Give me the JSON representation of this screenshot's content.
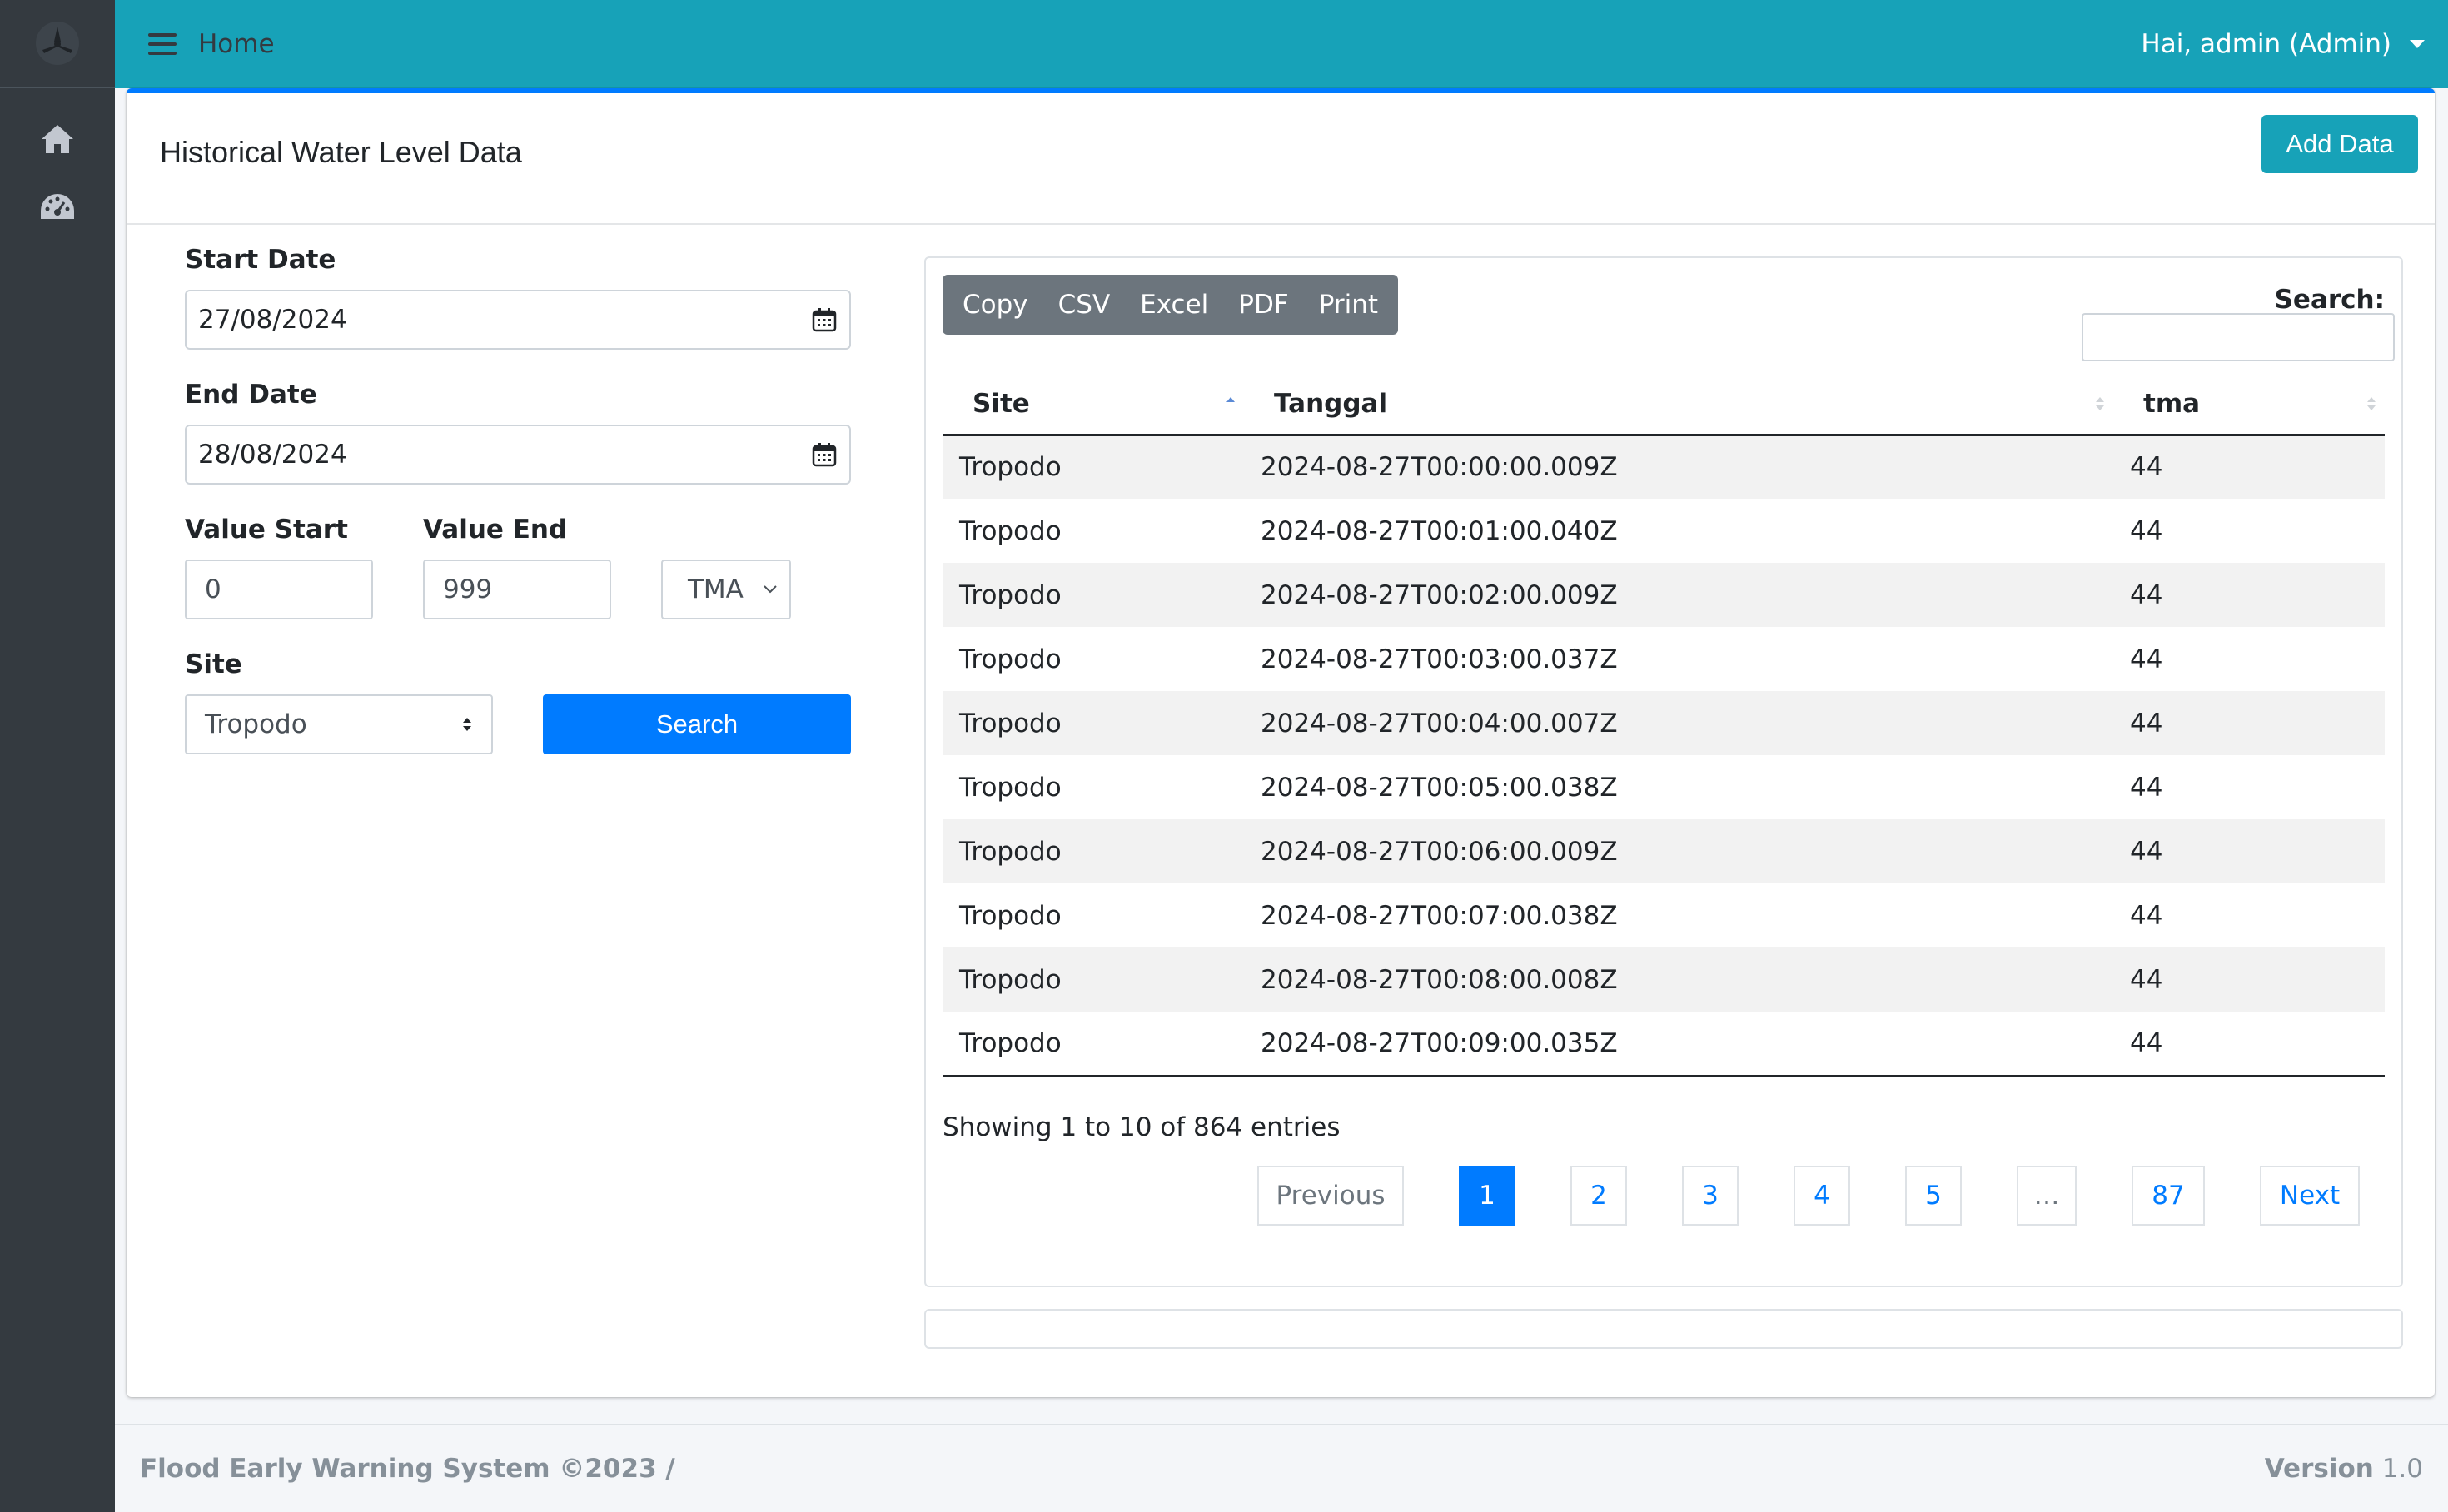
{
  "topbar": {
    "home_label": "Home",
    "user_label": "Hai, admin (Admin)"
  },
  "card": {
    "title": "Historical Water Level Data",
    "add_button": "Add Data"
  },
  "form": {
    "start_date_label": "Start Date",
    "start_date_value": "27/08/2024",
    "end_date_label": "End Date",
    "end_date_value": "28/08/2024",
    "value_start_label": "Value Start",
    "value_start_value": "0",
    "value_end_label": "Value End",
    "value_end_value": "999",
    "type_select_value": "TMA",
    "site_label": "Site",
    "site_select_value": "Tropodo",
    "search_button": "Search"
  },
  "table_panel": {
    "export_buttons": [
      "Copy",
      "CSV",
      "Excel",
      "PDF",
      "Print"
    ],
    "search_label": "Search:",
    "columns": [
      "Site",
      "Tanggal",
      "tma"
    ],
    "rows": [
      [
        "Tropodo",
        "2024-08-27T00:00:00.009Z",
        "44"
      ],
      [
        "Tropodo",
        "2024-08-27T00:01:00.040Z",
        "44"
      ],
      [
        "Tropodo",
        "2024-08-27T00:02:00.009Z",
        "44"
      ],
      [
        "Tropodo",
        "2024-08-27T00:03:00.037Z",
        "44"
      ],
      [
        "Tropodo",
        "2024-08-27T00:04:00.007Z",
        "44"
      ],
      [
        "Tropodo",
        "2024-08-27T00:05:00.038Z",
        "44"
      ],
      [
        "Tropodo",
        "2024-08-27T00:06:00.009Z",
        "44"
      ],
      [
        "Tropodo",
        "2024-08-27T00:07:00.038Z",
        "44"
      ],
      [
        "Tropodo",
        "2024-08-27T00:08:00.008Z",
        "44"
      ],
      [
        "Tropodo",
        "2024-08-27T00:09:00.035Z",
        "44"
      ]
    ],
    "info": "Showing 1 to 10 of 864 entries",
    "pagination": {
      "previous": "Previous",
      "pages": [
        "1",
        "2",
        "3",
        "4",
        "5",
        "…",
        "87"
      ],
      "next": "Next"
    }
  },
  "footer": {
    "left": "Flood Early Warning System ©2023 /",
    "version_label": "Version",
    "version_value": "1.0"
  },
  "colors": {
    "topbar": "#17a2b8",
    "sidebar": "#343a40",
    "primary": "#007bff",
    "secondary": "#6c757d"
  }
}
